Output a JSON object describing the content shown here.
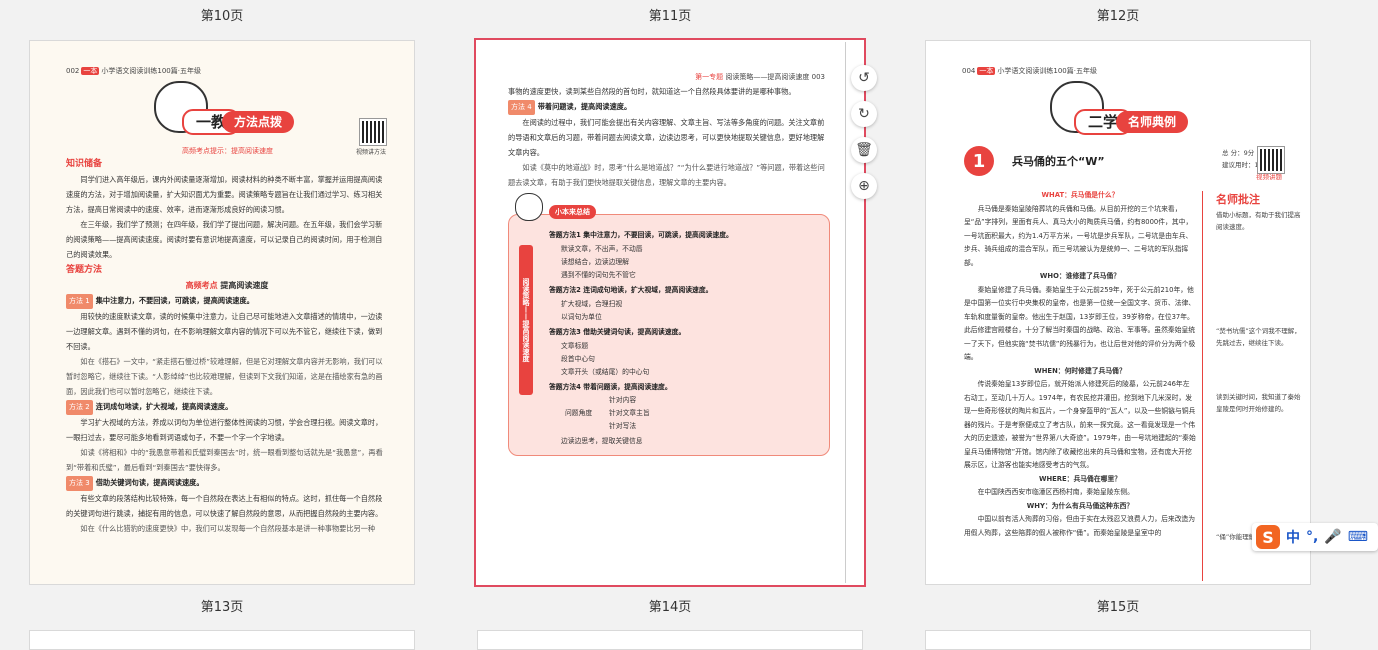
{
  "page_labels": {
    "top": [
      "第10页",
      "第11页",
      "第12页"
    ],
    "bottom": [
      "第13页",
      "第14页",
      "第15页"
    ]
  },
  "thumb13": {
    "header": "002",
    "header_tag": "一本",
    "header_title": "小学语文阅读训练100篇·五年级",
    "banner_big": "一教",
    "banner_small": "方法点拨",
    "subtitle": "高频考点提示：提高阅读速度",
    "qr_label": "视频讲方法",
    "sec1": "知识储备",
    "para1": "同学们进入高年级后，课内外阅读量逐渐增加，阅读材料的种类不断丰富，掌握并运用提高阅读速度的方法，对于增加阅读量，扩大知识面尤为重要。阅读策略专题旨在让我们通过学习、练习相关方法，提高日常阅读中的速度、效率，进而逐渐形成良好的阅读习惯。",
    "para2": "在三年级，我们学了预测；在四年级，我们学了提出问题，解决问题。在五年级，我们会学习新的阅读策略——提高阅读速度。阅读时要有意识地提高速度，可以记录自己的阅读时间，用于检测自己的阅读效果。",
    "sec2": "答题方法",
    "center_title": "高频考点",
    "center_title2": "提高阅读速度",
    "m1": "方法",
    "m1n": "1",
    "m1t": "集中注意力，不要回读，可跳读，提高阅读速度。",
    "m1p": "用较快的速度默读文章，读的时候集中注意力，让自己尽可能地进入文章描述的情境中，一边读一边理解文章。遇到不懂的词句，在不影响理解文章内容的情况下可以先不管它，继续往下读，做到不回读。",
    "m1ex": "如在《搭石》一文中，“紧走搭石慢过桥”较难理解，但是它对理解文章内容并无影响，我们可以暂时忽略它，继续往下读。“人影绰绰”也比较难理解，但读到下文我们知道，这是在描绘家有急的画面，因此我们也可以暂时忽略它，继续往下读。",
    "m2": "方法",
    "m2n": "2",
    "m2t": "连词成句地读，扩大视域，提高阅读速度。",
    "m2p": "学习扩大视域的方法，养成以词句为单位进行整体性阅读的习惯，学会合理扫视。阅读文章时，一眼扫过去，要尽可能多地看到词语或句子，不要一个字一个字地读。",
    "m2ex": "如读《将相和》中的“我愚意带着和氏璧到秦国去”时，统一眼看到整句话就先是“我愚意”，再看到“带着和氏璧”，最后看到“到秦国去”要快得多。",
    "m3": "方法",
    "m3n": "3",
    "m3t": "借助关键词句读，提高阅读速度。",
    "m3p": "有些文章的段落结构比较特殊，每一个自然段在表达上有相似的特点。这时，抓住每一个自然段的关键词句进行跳读，捕捉有用的信息，可以快速了解自然段的意思，从而把握自然段的主要内容。",
    "m3ex": "如在《什么比猎豹的速度更快》中，我们可以发现每一个自然段基本是讲一种事物要比另一种"
  },
  "thumb14": {
    "header": "第一专题",
    "header_title": "阅读策略——提高阅读速度",
    "header_num": "003",
    "line1": "事物的速度更快，读到某些自然段的首句时，就知道这一个自然段具体要讲的是哪种事物。",
    "m4": "方法",
    "m4n": "4",
    "m4t": "带着问题读，提高阅读速度。",
    "m4p": "在阅读的过程中，我们可能会提出有关内容理解、文章主旨、写法等多角度的问题。关注文章前的导语和文章后的习题，带着问题去阅读文章，边读边思考，可以更快地提取关键信息，更好地理解文章内容。",
    "m4ex": "如读《莫中的地道战》时，思考“什么是地道战？”“为什么要进行地道战？”等问题，带着这些问题去读文章，有助于我们更快地提取关键信息，理解文章的主要内容。",
    "mind_title": "小本来总结",
    "mind_vcol": "阅读策略——提高阅读速度",
    "mind_items": [
      "答题方法1  集中注意力，不要回读，可跳读，提高阅读速度。",
      "默读文章，不出声，不动唇",
      "读想结合，边读边理解",
      "遇到不懂的词句先不管它",
      "答题方法2  连词成句地读，扩大视域，提高阅读速度。",
      "扩大视域，合理扫视",
      "以词句为单位",
      "答题方法3  借助关键词句读，提高阅读速度。",
      "文章标题",
      "段首中心句",
      "文章开头（或结尾）的中心句",
      "答题方法4  带着问题读，提高阅读速度。",
      "问题角度",
      "针对内容",
      "针对文章主旨",
      "针对写法",
      "边读边思考，提取关键信息"
    ]
  },
  "thumb15": {
    "header": "004",
    "header_tag": "一本",
    "header_title": "小学语文阅读训练100篇·五年级",
    "banner_big": "二学",
    "banner_small": "名师典例",
    "num": "1",
    "article_title": "兵马俑的五个“W”",
    "score_total": "总  分：9分",
    "score_time": "建议用时：12分",
    "qr_label": "视频讲题",
    "q1": "WHAT：兵马俑是什么？",
    "p1": "兵马俑是秦始皇陵陪葬坑的兵俑和马俑。从目前开挖的三个坑来看，呈“品”字排列，里面有兵人、真马大小的陶质兵马俑，约有8000件，其中，一号坑面积最大，约为1.4万平方米，一号坑是步兵军队，二号坑是由车兵、步兵、骑兵组成的混合军队，而三号坑被认为是统帅一、二号坑的军队指挥部。",
    "q2": "WHO：谁修建了兵马俑？",
    "p2": "秦始皇修建了兵马俑。秦始皇生于公元前259年，死于公元前210年，他是中国第一位实行中央集权的皇帝，也是第一位统一全国文字、货币、法律、车轨和度量衡的皇帝。他出生于赵国，13岁即王位，39岁称帝，在位37年。此后修建宫殿楼台，十分了解当时秦国的战略、政治、军事等。虽然秦始皇统一了天下，但他实施“焚书坑儒”的残暴行为，也让后世对他的评价分为两个极端。",
    "q3": "WHEN：何时修建了兵马俑？",
    "p3": "传说秦始皇13岁即位后，就开始派人修建死后的陵墓，公元前246年左右动工，至动几十万人。1974年，有农民挖井灌田，挖到地下几米深时，发现一些奇形怪状的陶片和瓦片，一个身穿盔甲的“瓦人”，以及一些铜镞与铜兵器的残片。于是考察便成立了考古队，前来一探究竟。这一看竟发现是一个伟大的历史遗迹，被誉为“世界第八大奇迹”。1979年，由一号坑地建起的“秦始皇兵马俑博物馆”开馆。馆内除了收藏挖出来的兵马俑和宝物，还有庞大开挖展示区，让游客也能实地感受考古的气氛。",
    "q4": "WHERE：兵马俑在哪里？",
    "p4": "在中国陕西西安市临潼区西杨村南，秦始皇陵东侧。",
    "q5": "WHY：为什么有兵马俑这种东西？",
    "p5": "中国以前有活人殉葬的习俗，但由于实在太残忍又浪费人力，后来改造为用假人殉葬，这些陪葬的假人被称作“俑”。而秦始皇陵是皇室中的",
    "note_title": "名师批注",
    "note1": "借助小标题，有助于我们提高阅读速度。",
    "note2": "“焚书坑儒”这个词我不理解，先跳过去，继续往下读。",
    "note3": "读到关键时间，我知道了秦始皇陵是何时开始修建的。",
    "note4": "“俑”你能理解吗？"
  },
  "toolbar": {
    "rotate_left": "↺",
    "rotate_right": "↻",
    "delete": "🗑",
    "add": "⊕"
  },
  "ime": {
    "logo": "S",
    "lang": "中",
    "punct": "°,",
    "mic": "🎤",
    "kbd": "⌨"
  }
}
